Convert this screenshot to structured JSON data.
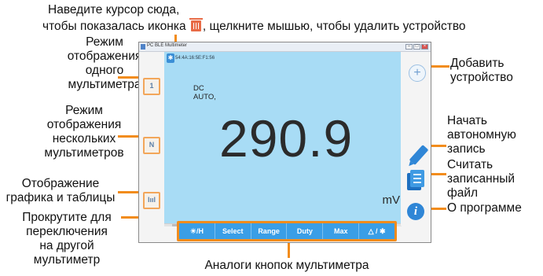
{
  "annotations": {
    "hover_delete_line1": "Наведите курсор сюда,",
    "hover_delete_line2_a": "чтобы показалась иконка",
    "hover_delete_line2_b": ", щелкните мышью, чтобы удалить устройство",
    "single_mode": [
      "Режим",
      "отображения",
      "одного",
      "мультиметра"
    ],
    "multi_mode": [
      "Режим",
      "отображения",
      "нескольких",
      "мультиметров"
    ],
    "chart_table_mode": [
      "Отображение",
      "графика и таблицы"
    ],
    "scroll_switch": [
      "Прокрутите для",
      "переключения",
      "на другой",
      "мультиметр"
    ],
    "add_device": [
      "Добавить",
      "устройство"
    ],
    "start_recording": [
      "Начать",
      "автономную",
      "запись"
    ],
    "read_file": [
      "Считать",
      "записанный",
      "файл"
    ],
    "about": "О программе",
    "button_analogs": "Аналоги кнопок мультиметра"
  },
  "window": {
    "title": "PC BLE Multimeter",
    "device_id": "54:4A:16:5E:F1:56",
    "mode_line1": "DC",
    "mode_line2": "AUTO,",
    "reading": "290.9",
    "unit": "mV",
    "left_buttons": [
      "1",
      "N",
      "lııl"
    ],
    "bottom_buttons": [
      "☀/H",
      "Select",
      "Range",
      "Duty",
      "Max",
      "△ / ✱"
    ]
  },
  "colors": {
    "accent_orange": "#f28c1c",
    "lcd_blue": "#a8dcf5",
    "button_blue": "#3a9ee6",
    "icon_blue": "#2f86d6",
    "trash_red": "#e86b46"
  },
  "icons": [
    "trash-icon",
    "bluetooth-icon",
    "add-device-icon",
    "pen-icon",
    "file-icon",
    "info-icon"
  ]
}
